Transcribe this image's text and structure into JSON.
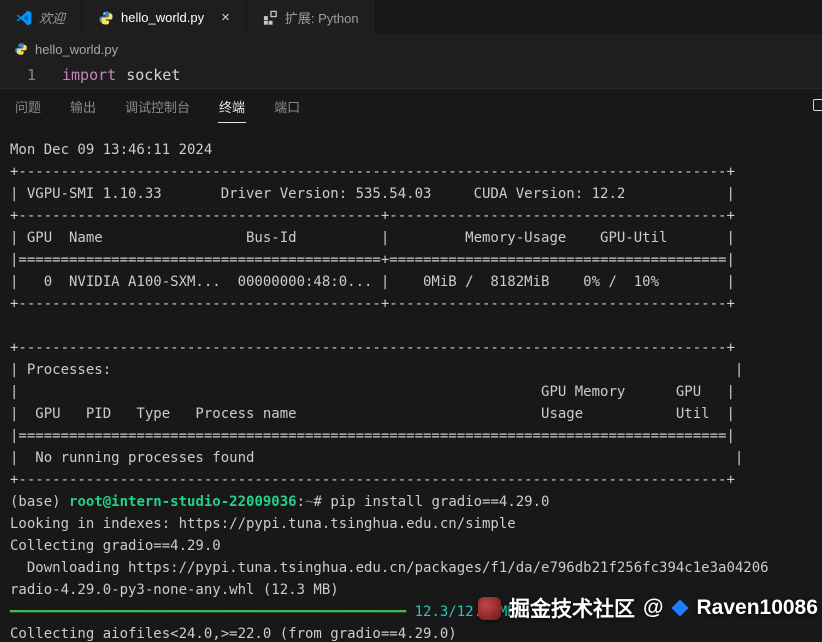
{
  "colors": {
    "accent-blue": "#0098ff",
    "prompt-green": "#23d18b",
    "path-blue": "#3b8eea",
    "progress-green": "#3fb950",
    "download-cyan": "#2bc5b4",
    "keyword-magenta": "#c586c0",
    "juejin-blue": "#1e80ff"
  },
  "tabbar": {
    "tabs": [
      {
        "label": "欢迎"
      },
      {
        "label": "hello_world.py"
      },
      {
        "label": "扩展: Python"
      }
    ],
    "close_glyph": "×"
  },
  "breadcrumb": {
    "file": "hello_world.py"
  },
  "editor": {
    "line_number": "1",
    "keyword": "import",
    "code": "socket"
  },
  "panel": {
    "tabs": [
      {
        "label": "问题"
      },
      {
        "label": "输出"
      },
      {
        "label": "调试控制台"
      },
      {
        "label": "终端"
      },
      {
        "label": "端口"
      }
    ]
  },
  "terminal": {
    "lines": [
      {
        "segments": [
          {
            "t": "Mon Dec 09 13:46:11 2024",
            "c": "fg"
          }
        ]
      },
      {
        "segments": [
          {
            "t": "+------------------------------------------------------------------------------------+",
            "c": "fg"
          }
        ]
      },
      {
        "segments": [
          {
            "t": "| VGPU-SMI 1.10.33       Driver Version: 535.54.03     CUDA Version: 12.2            |",
            "c": "fg"
          }
        ]
      },
      {
        "segments": [
          {
            "t": "+-------------------------------------------+----------------------------------------+",
            "c": "fg"
          }
        ]
      },
      {
        "segments": [
          {
            "t": "| GPU  Name                 Bus-Id          |         Memory-Usage    GPU-Util       |",
            "c": "fg"
          }
        ]
      },
      {
        "segments": [
          {
            "t": "|===========================================+========================================|",
            "c": "fg"
          }
        ]
      },
      {
        "segments": [
          {
            "t": "|   0  NVIDIA A100-SXM...  00000000:48:0... |    0MiB /  8182MiB    0% /  10%        |",
            "c": "fg"
          }
        ]
      },
      {
        "segments": [
          {
            "t": "+-------------------------------------------+----------------------------------------+",
            "c": "fg"
          }
        ]
      },
      {
        "segments": [
          {
            "t": " ",
            "c": "fg"
          }
        ]
      },
      {
        "segments": [
          {
            "t": "+------------------------------------------------------------------------------------+",
            "c": "fg"
          }
        ]
      },
      {
        "segments": [
          {
            "t": "| Processes:                                                                          |",
            "c": "fg"
          }
        ]
      },
      {
        "segments": [
          {
            "t": "|                                                              GPU Memory      GPU   |",
            "c": "fg"
          }
        ]
      },
      {
        "segments": [
          {
            "t": "|  GPU   PID   Type   Process name                             Usage           Util  |",
            "c": "fg"
          }
        ]
      },
      {
        "segments": [
          {
            "t": "|====================================================================================|",
            "c": "fg"
          }
        ]
      },
      {
        "segments": [
          {
            "t": "|  No running processes found                                                         |",
            "c": "fg"
          }
        ]
      },
      {
        "segments": [
          {
            "t": "+------------------------------------------------------------------------------------+",
            "c": "fg"
          }
        ]
      },
      {
        "segments": [
          {
            "t": "(base) ",
            "c": "fg"
          },
          {
            "t": "root@intern-studio-22009036",
            "c": "green"
          },
          {
            "t": ":",
            "c": "fg"
          },
          {
            "t": "~",
            "c": "blue"
          },
          {
            "t": "# pip install gradio==4.29.0",
            "c": "fg"
          }
        ]
      },
      {
        "segments": [
          {
            "t": "Looking in indexes: https://pypi.tuna.tsinghua.edu.cn/simple",
            "c": "fg"
          }
        ]
      },
      {
        "segments": [
          {
            "t": "Collecting gradio==4.29.0",
            "c": "fg"
          }
        ]
      },
      {
        "segments": [
          {
            "t": "  Downloading https://pypi.tuna.tsinghua.edu.cn/packages/f1/da/e796db21f256fc394c1e3a04206",
            "c": "fg"
          }
        ]
      },
      {
        "segments": [
          {
            "t": "radio-4.29.0-py3-none-any.whl (12.3 MB)",
            "c": "fg"
          }
        ]
      },
      {
        "segments": [
          {
            "t": "━━━━━━━━━━━━━━━━━━━━━━━━━━━━━━━━━━━━━━━━━━━━━━━",
            "c": "bar"
          },
          {
            "t": " ",
            "c": "fg"
          },
          {
            "t": "12.3/12.3 MB",
            "c": "cyan"
          }
        ]
      },
      {
        "segments": [
          {
            "t": "Collecting aiofiles<24.0,>=22.0 (from gradio==4.29.0)",
            "c": "fg"
          }
        ]
      }
    ]
  },
  "watermark": {
    "site": "掘金技术社区",
    "separator": "@",
    "handle": "Raven10086"
  }
}
